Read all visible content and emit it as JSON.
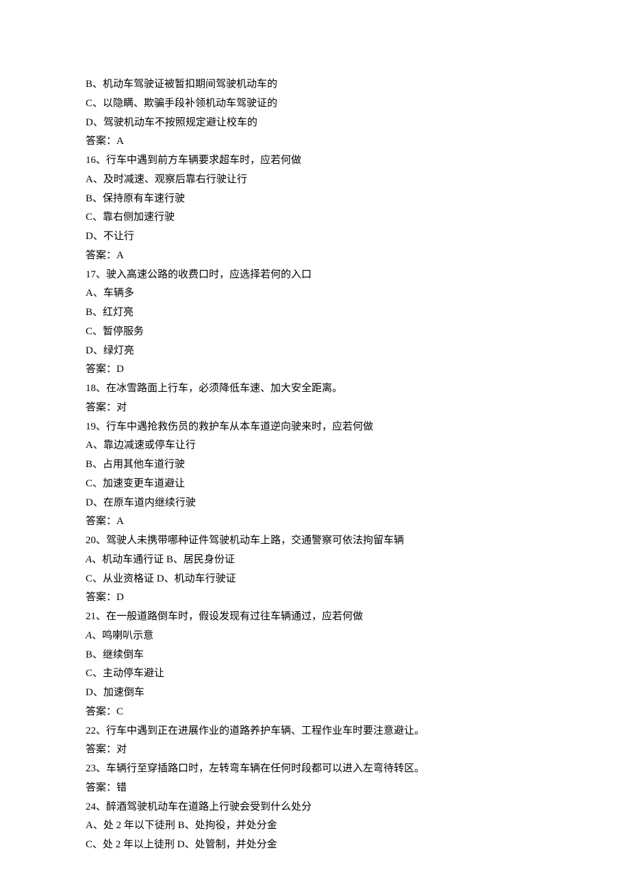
{
  "lines": [
    {
      "text": "B、机动车驾驶证被暂扣期间驾驶机动车的"
    },
    {
      "text": "C、以隐瞒、欺骗手段补领机动车驾驶证的"
    },
    {
      "text": "D、驾驶机动车不按照规定避让校车的"
    },
    {
      "text": "答案：A"
    },
    {
      "text": "16、行车中遇到前方车辆要求超车时，应若何做"
    },
    {
      "text": "A、及时减速、观察后靠右行驶让行"
    },
    {
      "text": "B、保持原有车速行驶"
    },
    {
      "text": "C、靠右侧加速行驶"
    },
    {
      "text": "D、不让行"
    },
    {
      "text": "答案：A"
    },
    {
      "text": "17、驶入高速公路的收费口时，应选择若何的入口"
    },
    {
      "text": "A、车辆多"
    },
    {
      "text": "B、红灯亮"
    },
    {
      "text": "C、暂停服务"
    },
    {
      "text": "D、绿灯亮"
    },
    {
      "text": "答案：D"
    },
    {
      "text": "18、在冰雪路面上行车，必须降低车速、加大安全距离。"
    },
    {
      "text": "答案：对"
    },
    {
      "text": "19、行车中遇抢救伤员的救护车从本车道逆向驶来时，应若何做"
    },
    {
      "text": "A、靠边减速或停车让行"
    },
    {
      "text": "B、占用其他车道行驶"
    },
    {
      "text": "C、加速变更车道避让"
    },
    {
      "text": "D、在原车道内继续行驶"
    },
    {
      "text": "答案：A"
    },
    {
      "text": "20、驾驶人未携带哪种证件驾驶机动车上路，交通警察可依法拘留车辆"
    },
    {
      "prefix": "A",
      "italic": true,
      "rest": "、机动车通行证 B、居民身份证"
    },
    {
      "text": "C、从业资格证 D、机动车行驶证"
    },
    {
      "text": "答案：D"
    },
    {
      "text": "21、在一般道路倒车时，假设发现有过往车辆通过，应若何做"
    },
    {
      "prefix": "A",
      "italic": true,
      "rest": "、鸣喇叭示意"
    },
    {
      "text": "B、继续倒车"
    },
    {
      "text": "C、主动停车避让"
    },
    {
      "text": "D、加速倒车"
    },
    {
      "text": "答案：C"
    },
    {
      "text": "22、行车中遇到正在进展作业的道路养护车辆、工程作业车时要注意避让。"
    },
    {
      "text": "答案：对"
    },
    {
      "text": "23、车辆行至穿插路口时，左转弯车辆在任何时段都可以进入左弯待转区。"
    },
    {
      "text": "答案：错"
    },
    {
      "text": "24、醉酒驾驶机动车在道路上行驶会受到什么处分"
    },
    {
      "text": "A、处 2 年以下徒刑 B、处拘役，并处分金"
    },
    {
      "text": "C、处 2 年以上徒刑 D、处管制，并处分金"
    }
  ]
}
